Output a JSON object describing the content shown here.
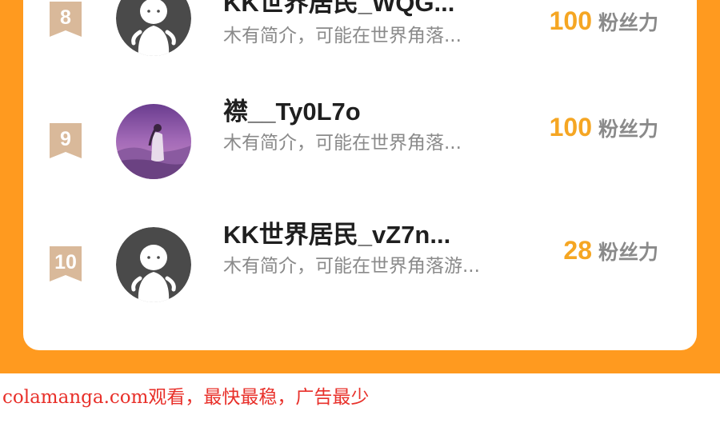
{
  "ranking": {
    "entries": [
      {
        "rank": "8",
        "name": "KK世界居民_WQG...",
        "bio": "木有简介，可能在世界角落...",
        "score": "100",
        "score_unit": "粉丝力",
        "avatar": "default-avatar-icon"
      },
      {
        "rank": "9",
        "name": "襟__Ty0L7o",
        "bio": "木有简介，可能在世界角落...",
        "score": "100",
        "score_unit": "粉丝力",
        "avatar": "photo-avatar"
      },
      {
        "rank": "10",
        "name": "KK世界居民_vZ7n...",
        "bio": "木有简介，可能在世界角落游...",
        "score": "28",
        "score_unit": "粉丝力",
        "avatar": "default-avatar-icon"
      }
    ]
  },
  "watermark": {
    "text": "colamanga.com观看，最快最稳，广告最少"
  },
  "colors": {
    "panel": "#ff9a1f",
    "score": "#f5a623",
    "rank_badge": "#d9b99a",
    "watermark": "#e8302a"
  }
}
